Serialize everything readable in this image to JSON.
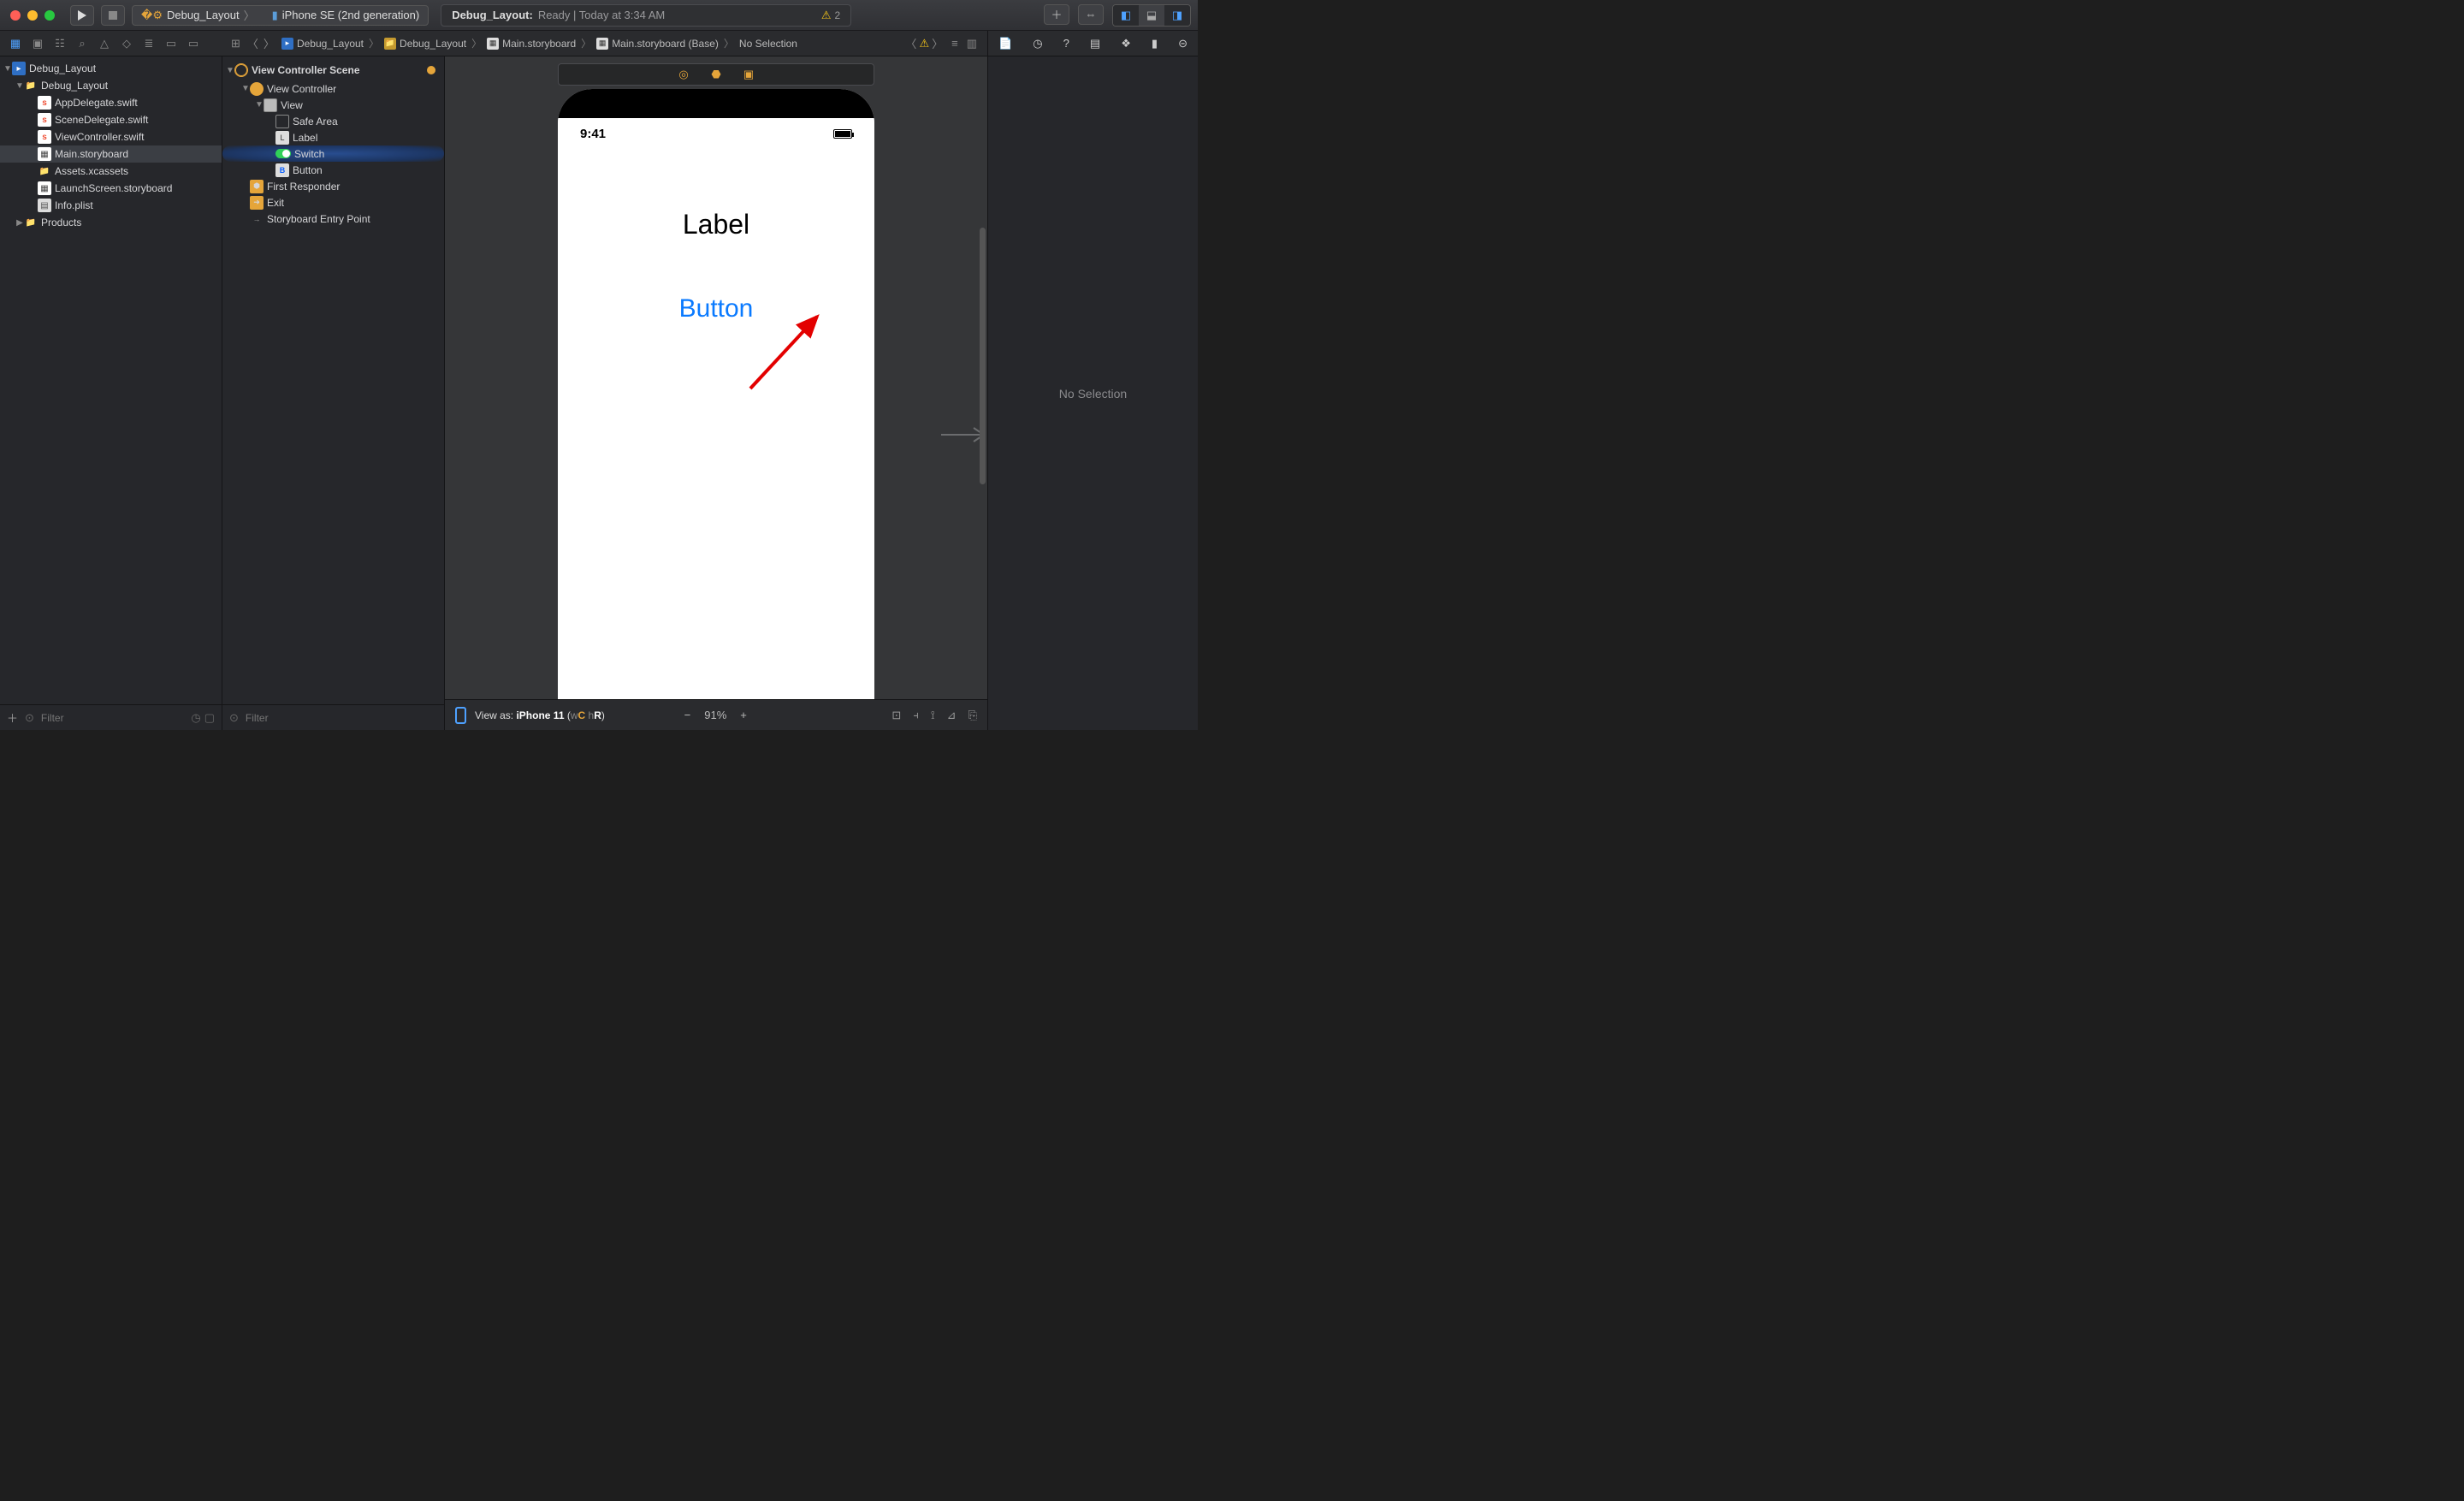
{
  "titlebar": {
    "scheme_target": "Debug_Layout",
    "scheme_device": "iPhone SE (2nd generation)",
    "status_project": "Debug_Layout:",
    "status_state": "Ready",
    "status_sep": "|",
    "status_time": "Today at 3:34 AM",
    "warning_count": "2"
  },
  "jumpbar": {
    "p0": "Debug_Layout",
    "p1": "Debug_Layout",
    "p2": "Main.storyboard",
    "p3": "Main.storyboard (Base)",
    "p4": "No Selection"
  },
  "nav": {
    "root": "Debug_Layout",
    "group": "Debug_Layout",
    "files": [
      "AppDelegate.swift",
      "SceneDelegate.swift",
      "ViewController.swift",
      "Main.storyboard",
      "Assets.xcassets",
      "LaunchScreen.storyboard",
      "Info.plist"
    ],
    "products": "Products",
    "filter_placeholder": "Filter"
  },
  "outline": {
    "scene": "View Controller Scene",
    "vc": "View Controller",
    "view": "View",
    "safe": "Safe Area",
    "label": "Label",
    "switch": "Switch",
    "button": "Button",
    "fr": "First Responder",
    "exit": "Exit",
    "entry": "Storyboard Entry Point",
    "filter_placeholder": "Filter"
  },
  "canvas": {
    "status_time": "9:41",
    "label_text": "Label",
    "button_text": "Button",
    "view_as_prefix": "View as: ",
    "view_as_device": "iPhone 11",
    "wc": "C",
    "hr": "R",
    "zoom": "91%"
  },
  "inspector": {
    "empty": "No Selection"
  }
}
